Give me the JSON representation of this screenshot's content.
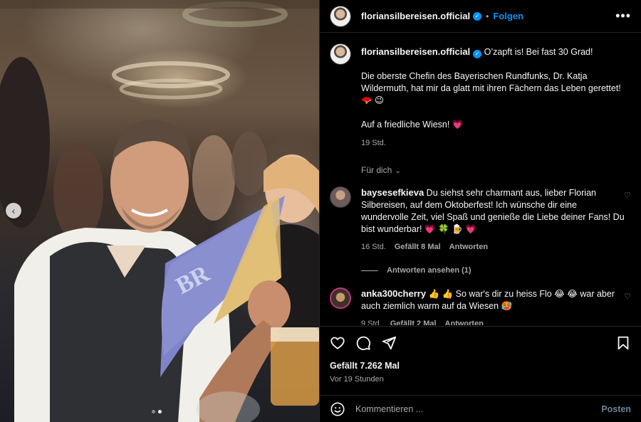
{
  "header": {
    "username": "floriansilbereisen.official",
    "separator": "•",
    "follow_label": "Folgen",
    "more_label": "•••"
  },
  "caption": {
    "username": "floriansilbereisen.official",
    "line1": "O’zapft is! Bei fast 30 Grad!",
    "line2": "Die oberste Chefin des Bayerischen Rundfunks, Dr. Katja Wildermuth, hat mir da glatt mit ihren Fächern das Leben gerettet! 🪭 😉",
    "line3": "Auf a friedliche Wiesn! 💗",
    "time": "19 Std."
  },
  "for_you": {
    "label": "Für dich",
    "chevron": "⌄"
  },
  "comments": [
    {
      "username": "baysesefkieva",
      "text": "Du siehst sehr charmant aus, lieber Florian Silbereisen, auf dem Oktoberfest! Ich wünsche dir eine wundervolle Zeit, viel Spaß und genieße die Liebe deiner Fans! Du bist wunderbar! 💗 🍀 🍺 💗",
      "time": "16 Std.",
      "likes": "Gefällt 8 Mal",
      "reply": "Antworten",
      "view_replies": "Antworten ansehen (1)"
    },
    {
      "username": "anka300cherry",
      "text": "👍 👍 So war's dir zu heiss Flo 😂 😂 war aber auch ziemlich warm auf da Wiesen 🥵",
      "time": "9 Std.",
      "likes": "Gefällt 2 Mal",
      "reply": "Antworten"
    }
  ],
  "post": {
    "likes": "Gefällt 7.262 Mal",
    "ago": "Vor 19 Stunden"
  },
  "comment_box": {
    "placeholder": "Kommentieren ...",
    "post_label": "Posten"
  },
  "icons": {
    "heart": "heart-icon",
    "comment": "comment-icon",
    "share": "share-icon",
    "bookmark": "bookmark-icon",
    "emoji": "emoji-icon",
    "prev": "chevron-left-icon"
  },
  "carousel": {
    "count": 2,
    "active": 2
  },
  "colors": {
    "background": "#000000",
    "text": "#f5f5f5",
    "secondary": "#a8a8a8",
    "link": "#0095f6",
    "border": "#262626"
  }
}
